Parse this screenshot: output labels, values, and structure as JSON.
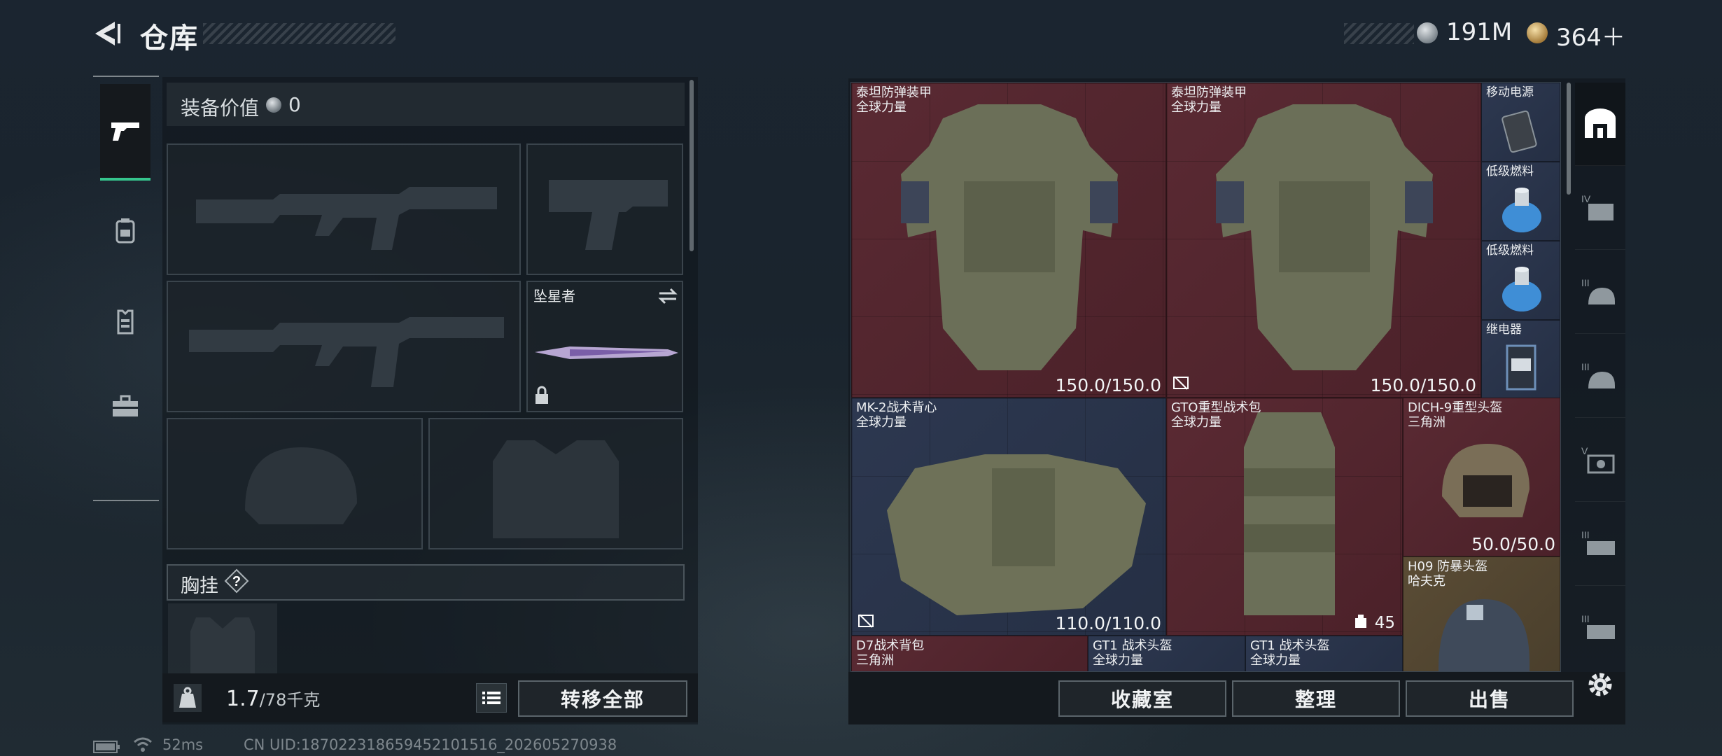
{
  "header": {
    "title": "仓库",
    "currency_silver": "191M",
    "currency_gold": "364＋"
  },
  "left_tabs": [
    "weapon-tab",
    "backpack-tab",
    "rig-tab",
    "case-tab"
  ],
  "equipment": {
    "value_label": "装备价值",
    "value_amount": "0",
    "melee_name": "坠星者",
    "chest_label": "胸挂",
    "chest_help": "?",
    "weight_current": "1.7",
    "weight_max": "/78千克",
    "transfer_all": "转移全部"
  },
  "inventory": {
    "items": [
      {
        "name": "泰坦防弹装甲",
        "sub": "全球力量",
        "durability": "150.0/150.0"
      },
      {
        "name": "泰坦防弹装甲",
        "sub": "全球力量",
        "durability": "150.0/150.0"
      },
      {
        "name": "移动电源"
      },
      {
        "name": "低级燃料"
      },
      {
        "name": "低级燃料"
      },
      {
        "name": "继电器"
      },
      {
        "name": "MK-2战术背心",
        "sub": "全球力量",
        "durability": "110.0/110.0"
      },
      {
        "name": "GTO重型战术包",
        "sub": "全球力量",
        "count": "45"
      },
      {
        "name": "DICH-9重型头盔",
        "sub": "三角洲",
        "durability": "50.0/50.0"
      },
      {
        "name": "H09 防暴头盔",
        "sub": "哈夫克"
      },
      {
        "name": "D7战术背包",
        "sub": "三角洲"
      },
      {
        "name": "GT1 战术头盔",
        "sub": "全球力量"
      },
      {
        "name": "GT1 战术头盔",
        "sub": "全球力量"
      }
    ],
    "buttons": {
      "collection": "收藏室",
      "sort": "整理",
      "sell": "出售"
    }
  },
  "filters": [
    "all-filter",
    "armor-iv-filter",
    "helmet-iii-filter",
    "helmet-iii-b-filter",
    "armor-v-filter",
    "rig-iii-filter",
    "rig-iii-b-filter"
  ],
  "status_bar": {
    "ping": "52ms",
    "uid": "CN UID:1870223186594521015​16_202605270938"
  }
}
